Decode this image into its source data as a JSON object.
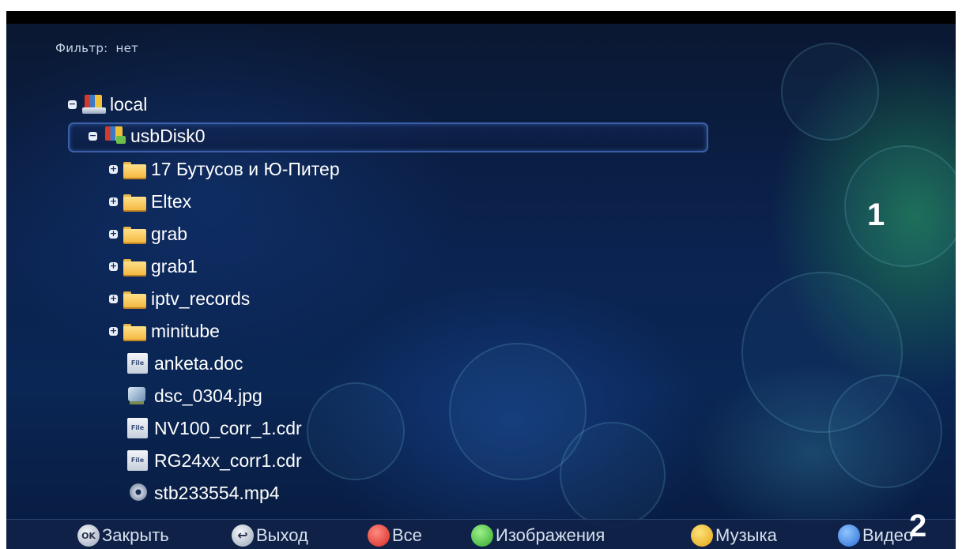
{
  "filter": {
    "label": "Фильтр:",
    "value": "нет"
  },
  "tree": {
    "items": [
      {
        "label": "local",
        "type": "drive",
        "toggle": "−",
        "icon": "local-drive-icon"
      },
      {
        "label": "usbDisk0",
        "type": "usb",
        "toggle": "−",
        "icon": "usb-disk-icon",
        "selected": true
      },
      {
        "label": "17  Бутусов и Ю-Питер",
        "type": "folder",
        "toggle": "+",
        "icon": "folder-icon"
      },
      {
        "label": "Eltex",
        "type": "folder",
        "toggle": "+",
        "icon": "folder-icon"
      },
      {
        "label": "grab",
        "type": "folder",
        "toggle": "+",
        "icon": "folder-icon"
      },
      {
        "label": "grab1",
        "type": "folder",
        "toggle": "+",
        "icon": "folder-icon"
      },
      {
        "label": "iptv_records",
        "type": "folder",
        "toggle": "+",
        "icon": "folder-icon"
      },
      {
        "label": "minitube",
        "type": "folder",
        "toggle": "+",
        "icon": "folder-icon"
      },
      {
        "label": "anketa.doc",
        "type": "file",
        "toggle": "",
        "icon": "file-icon"
      },
      {
        "label": "dsc_0304.jpg",
        "type": "image",
        "toggle": "",
        "icon": "image-file-icon"
      },
      {
        "label": "NV100_corr_1.cdr",
        "type": "file",
        "toggle": "",
        "icon": "file-icon"
      },
      {
        "label": "RG24xx_corr1.cdr",
        "type": "file",
        "toggle": "",
        "icon": "file-icon"
      },
      {
        "label": "stb233554.mp4",
        "type": "video",
        "toggle": "",
        "icon": "video-file-icon"
      }
    ]
  },
  "bottom_bar": {
    "close": {
      "key": "OK",
      "label": "Закрыть"
    },
    "exit": {
      "label": "Выход"
    },
    "all": {
      "label": "Все"
    },
    "images": {
      "label": "Изображения"
    },
    "music": {
      "label": "Музыка"
    },
    "video": {
      "label": "Видео"
    }
  },
  "markers": {
    "one": "1",
    "two": "2"
  },
  "colors": {
    "red": "#d42a22",
    "green": "#2fa82c",
    "yellow": "#e0a414",
    "blue": "#2a6fd4",
    "selection_border": "#3a5fa8"
  }
}
